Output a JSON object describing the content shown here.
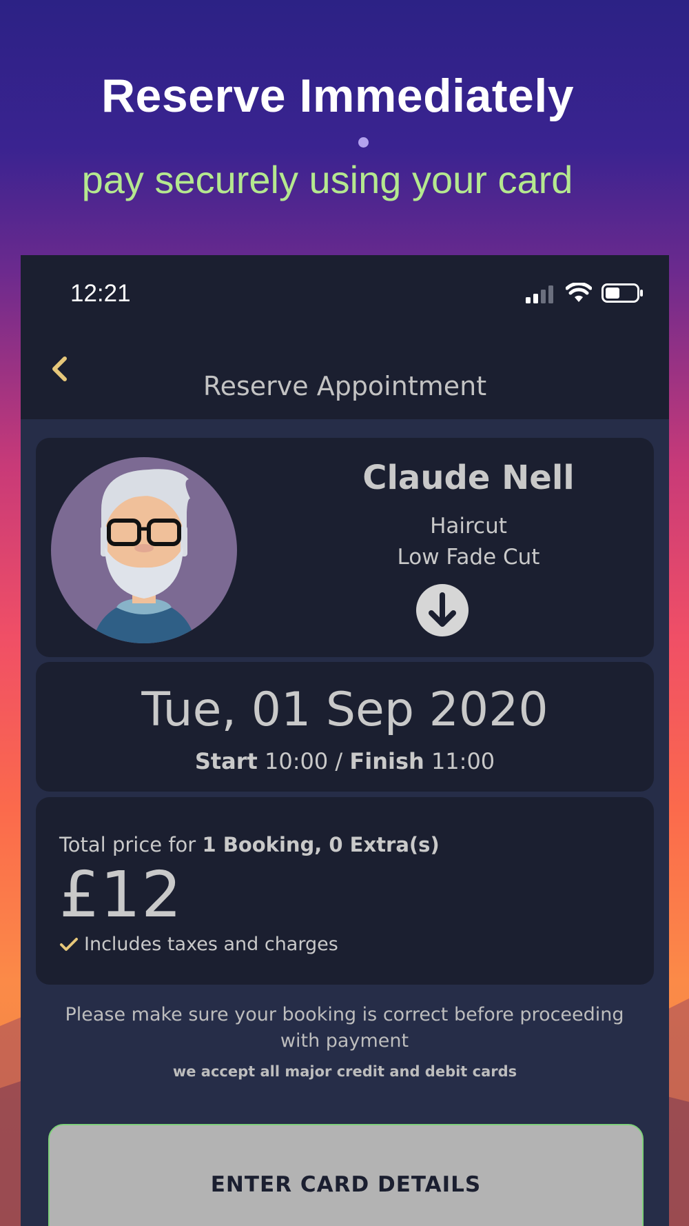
{
  "promo": {
    "title": "Reserve Immediately",
    "subtitle": "pay securely using your card"
  },
  "status_bar": {
    "time": "12:21",
    "icons": [
      "signal-icon",
      "wifi-icon",
      "battery-icon"
    ]
  },
  "nav": {
    "back_icon": "chevron-left-icon",
    "title": "Reserve Appointment"
  },
  "booking": {
    "barber_name": "Claude Nell",
    "service_category": "Haircut",
    "service_name": "Low Fade Cut",
    "expand_icon": "arrow-down-circle-icon",
    "date": "Tue, 01 Sep 2020",
    "start_label": "Start",
    "start_time": "10:00",
    "separator": "/",
    "finish_label": "Finish",
    "finish_time": "11:00"
  },
  "price": {
    "prefix": "Total price for",
    "summary": "1 Booking, 0 Extra(s)",
    "amount": "£12",
    "includes": "Includes taxes and charges"
  },
  "notice": {
    "main": "Please make sure your booking is correct before proceeding with payment",
    "cards": "we accept all major credit and debit cards"
  },
  "actions": {
    "enter_card_label": "ENTER CARD DETAILS"
  },
  "colors": {
    "accent_gold": "#e6c77a",
    "subtitle_green": "#b5e88f",
    "card_bg": "#1b1f30",
    "screen_bg": "#262d48",
    "button_border": "#7fd07a"
  }
}
